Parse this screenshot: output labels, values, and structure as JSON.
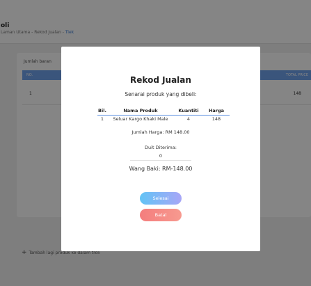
{
  "page": {
    "title": "oli",
    "breadcrumb": {
      "home": "Laman Utama",
      "separator_1": " - ",
      "sales": "Rekod Jualan",
      "separator_2": " - ",
      "current": "Tiek"
    },
    "total_label": "Jumlah baran",
    "table": {
      "col_no": "NO.",
      "col_total": "TOTAL PRICE",
      "row": {
        "no": "1",
        "total": "148"
      }
    },
    "add_link": {
      "icon": "plus-icon",
      "plus": "+",
      "label": "Tambah lagi produk ke dalam troli"
    }
  },
  "modal": {
    "title": "Rekod Jualan",
    "subtitle": "Senarai produk yang dibeli:",
    "columns": [
      "Bil.",
      "Nama Produk",
      "Kuantiti",
      "Harga"
    ],
    "items": [
      {
        "bil": "1",
        "nama": "Seluar Kargo Khaki Male",
        "kuantiti": "4",
        "harga": "148"
      }
    ],
    "total_harga": "Jumlah Harga: RM 148.00",
    "duit_label": "Duit Diterima:",
    "duit_value": "0",
    "wang_baki": "Wang Baki: RM-148.00",
    "btn_selesai": "Selesai",
    "btn_batal": "Batal"
  },
  "colors": {
    "accent": "#6fa3ee",
    "selesai_gradient": [
      "#62c3f5",
      "#a8a6f7"
    ],
    "batal_gradient": [
      "#f47d7d",
      "#f79a8f"
    ]
  }
}
